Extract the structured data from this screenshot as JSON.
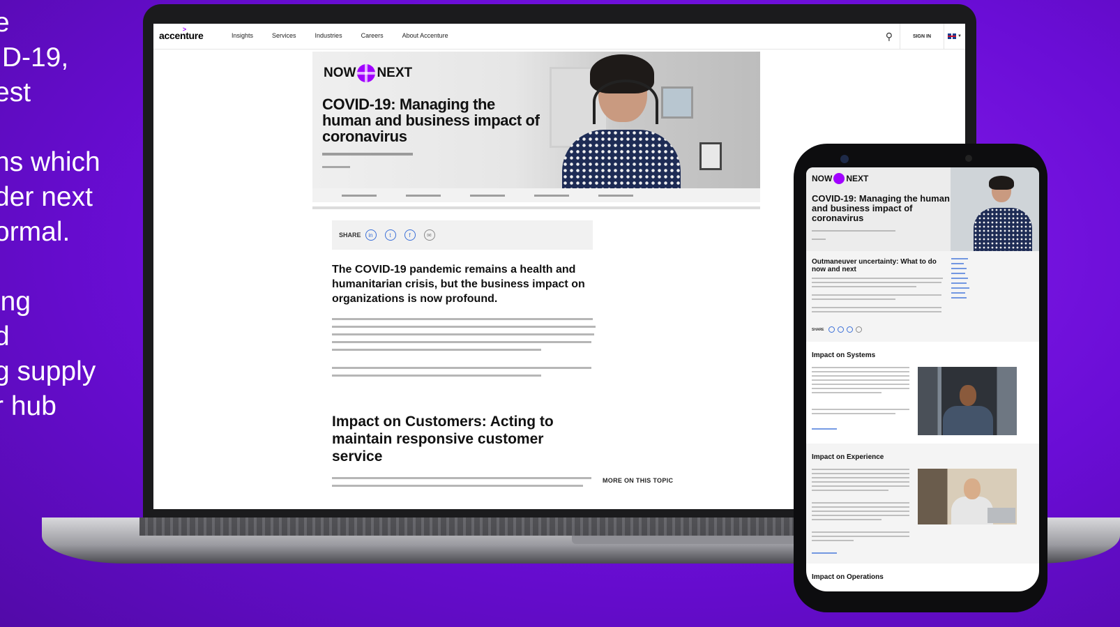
{
  "promo_text": {
    "lines": [
      "e",
      "ID-19,",
      "est",
      "",
      "ns which",
      "der next",
      "ormal.",
      "",
      "ing",
      "d",
      "g supply",
      "r hub"
    ]
  },
  "site": {
    "logo": "accenture",
    "logo_mark": ">",
    "nav": [
      "Insights",
      "Services",
      "Industries",
      "Careers",
      "About Accenture"
    ],
    "sign_in": "SIGN IN",
    "flag_icon": "uk-flag-icon",
    "search_icon": "search-icon"
  },
  "hero": {
    "brand_left": "NOW",
    "brand_right": "NEXT",
    "title": "COVID-19: Managing the human and business impact of coronavirus"
  },
  "share": {
    "label": "SHARE",
    "icons": [
      "linkedin-icon",
      "twitter-icon",
      "facebook-icon",
      "email-icon"
    ]
  },
  "article": {
    "heading": "The COVID-19 pandemic remains a health and humanitarian crisis, but the business impact on organizations is now profound.",
    "section_heading": "Impact on Customers: Acting to maintain responsive customer service",
    "more_on_topic": "MORE ON THIS TOPIC"
  },
  "phone": {
    "brand_left": "NOW",
    "brand_right": "NEXT",
    "title": "COVID-19: Managing the human and business impact of coronavirus",
    "intro_heading": "Outmaneuver uncertainty: What to do now and next",
    "share_label": "SHARE",
    "sections": [
      "Impact on Systems",
      "Impact on Experience",
      "Impact on Operations"
    ]
  },
  "colors": {
    "background": "#6a0dd6",
    "accent": "#a100ff",
    "link": "#3a6fd8"
  }
}
